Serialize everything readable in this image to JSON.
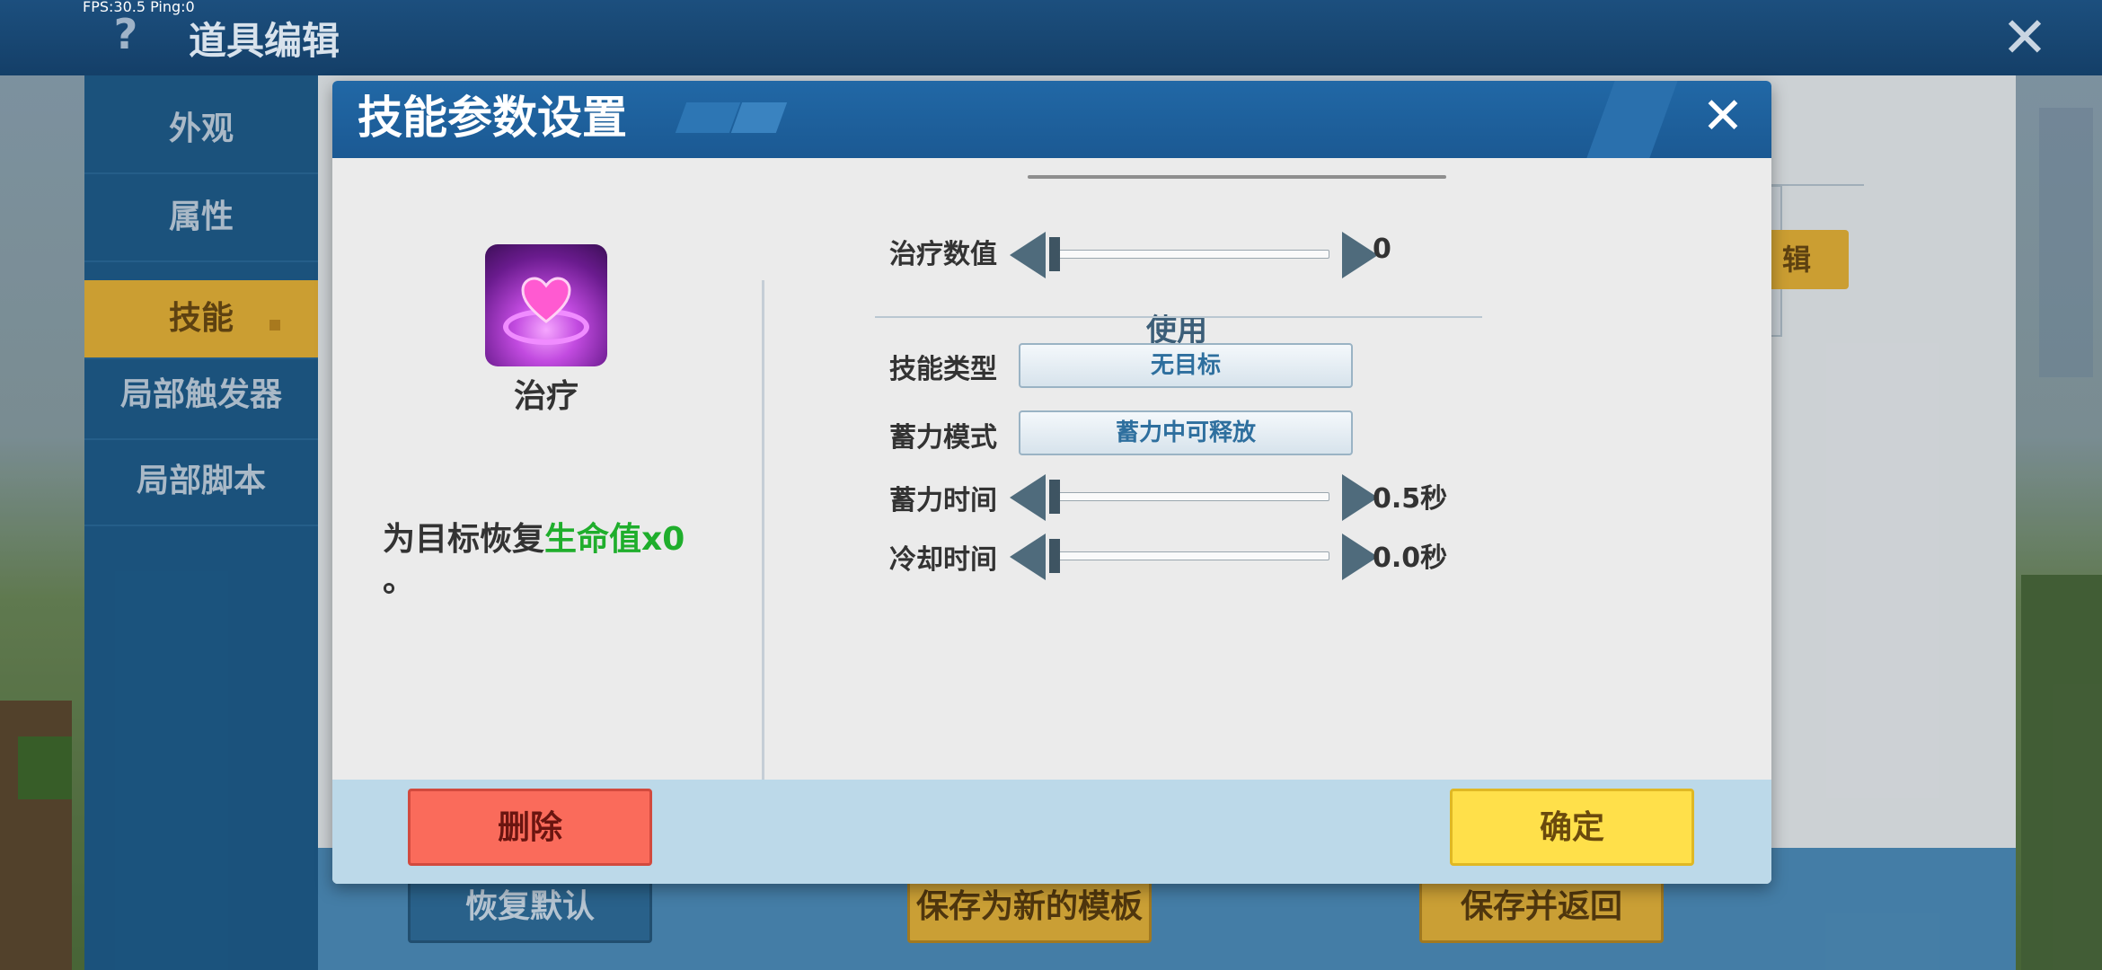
{
  "status": {
    "fps_text": "FPS:30.5  Ping:0"
  },
  "header": {
    "title": "道具编辑",
    "help_glyph": "?",
    "close_glyph": "✕"
  },
  "sidebar": {
    "items": [
      {
        "label": "外观"
      },
      {
        "label": "属性"
      },
      {
        "label": "技能",
        "active": true
      },
      {
        "label": "局部触发器"
      },
      {
        "label": "局部脚本"
      }
    ]
  },
  "background_buttons": {
    "edit_label": "辑",
    "restore_default": "恢复默认",
    "save_template": "保存为新的模板",
    "save_return": "保存并返回"
  },
  "dialog": {
    "title": "技能参数设置",
    "close_glyph": "✕",
    "skill": {
      "name": "治疗",
      "icon": "heal-heart-icon",
      "desc_prefix": "为目标恢复",
      "desc_highlight": "生命值",
      "desc_suffix": "x0",
      "desc_line2": "。"
    },
    "heal_value": {
      "label": "治疗数值",
      "value": "0"
    },
    "use_section": {
      "title": "使用"
    },
    "skill_type": {
      "label": "技能类型",
      "selected": "无目标"
    },
    "charge_mode": {
      "label": "蓄力模式",
      "selected": "蓄力中可释放"
    },
    "charge_time": {
      "label": "蓄力时间",
      "value": "0.5秒"
    },
    "cooldown_time": {
      "label": "冷却时间",
      "value": "0.0秒"
    },
    "footer": {
      "delete_label": "删除",
      "confirm_label": "确定"
    }
  },
  "colors": {
    "accent_blue": "#1b5993",
    "active_tab": "#e7b43a",
    "highlight_green": "#1fae2c",
    "delete_red": "#fa6b5b",
    "confirm_yellow": "#ffe04a"
  }
}
